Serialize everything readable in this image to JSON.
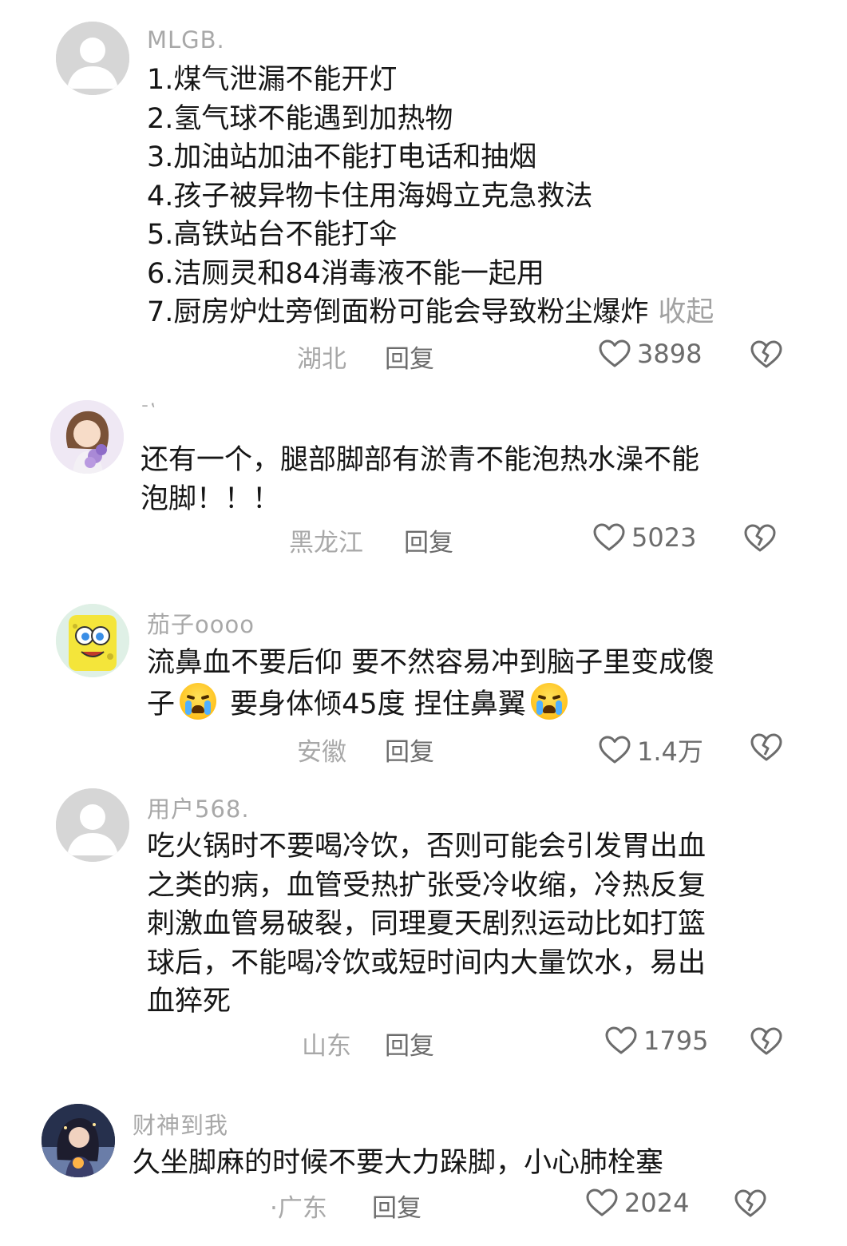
{
  "comments": [
    {
      "username": "MLGB.",
      "lines": [
        "1.煤气泄漏不能开灯",
        "2.氢气球不能遇到加热物",
        "3.加油站加油不能打电话和抽烟",
        "4.孩子被异物卡住用海姆立克急救法",
        "5.高铁站台不能打伞",
        "6.洁厕灵和84消毒液不能一起用",
        "7.厨房炉灶旁倒面粉可能会导致粉尘爆炸"
      ],
      "collapse": "收起",
      "location": "湖北",
      "reply": "回复",
      "likes": "3898",
      "avatar": "default-avatar"
    },
    {
      "username": "ˉʽ",
      "lines": [
        "还有一个，腿部脚部有淤青不能泡热水澡不能",
        "泡脚！！！"
      ],
      "location": "黑龙江",
      "reply": "回复",
      "likes": "5023",
      "avatar": "girl-with-flowers-avatar"
    },
    {
      "username": "茄子oooo",
      "lines_rich": [
        [
          "流鼻血不要后仰 要不然容易冲到脑子里变成傻"
        ],
        [
          "子",
          "crying-emoji",
          " 要身体倾45度 捏住鼻翼",
          "crying-emoji"
        ]
      ],
      "location": "安徽",
      "reply": "回复",
      "likes": "1.4万",
      "avatar": "spongebob-avatar"
    },
    {
      "username": "用户568.",
      "lines": [
        "吃火锅时不要喝冷饮，否则可能会引发胃出血",
        "之类的病，血管受热扩张受冷收缩，冷热反复",
        "刺激血管易破裂，同理夏天剧烈运动比如打篮",
        "球后，不能喝冷饮或短时间内大量饮水，易出",
        "血猝死"
      ],
      "location": "山东",
      "reply": "回复",
      "likes": "1795",
      "avatar": "default-avatar"
    },
    {
      "username": "财神到我",
      "lines": [
        "久坐脚麻的时候不要大力跺脚，小心肺栓塞"
      ],
      "location": "·广东",
      "reply": "回复",
      "likes": "2024",
      "avatar": "anime-girl-avatar"
    }
  ],
  "colors": {
    "text": "#161616",
    "muted": "#a8a8a8",
    "action": "#6c6c6c"
  },
  "icons": [
    "heart-icon",
    "broken-heart-icon"
  ]
}
